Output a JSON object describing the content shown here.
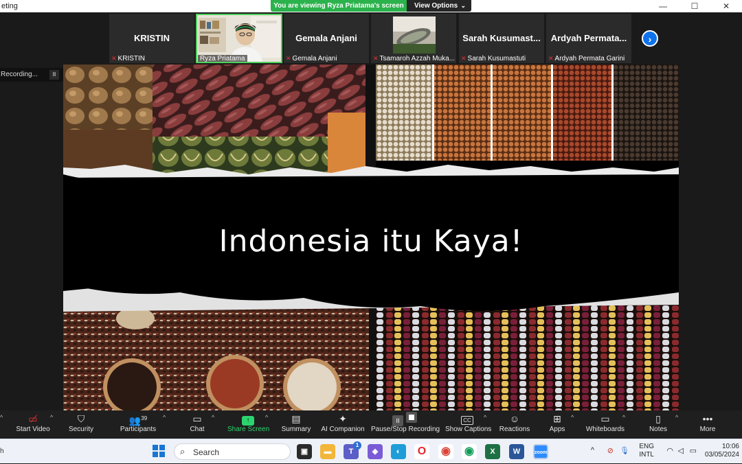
{
  "window": {
    "title": "eting",
    "controls": [
      "—",
      "☐",
      "✕"
    ]
  },
  "banner": {
    "viewing": "You are viewing Ryza Priatama's screen",
    "view_options": "View Options"
  },
  "participants": [
    {
      "name_big": "KRISTIN",
      "label": "KRISTIN",
      "muted": true,
      "video": false
    },
    {
      "name_big": "",
      "label": "Ryza Priatama",
      "muted": false,
      "video": true
    },
    {
      "name_big": "Gemala Anjani",
      "label": "Gemala Anjani",
      "muted": true,
      "video": false
    },
    {
      "name_big": "",
      "label": "Tsamaroh Azzah Muka...",
      "muted": true,
      "video": true
    },
    {
      "name_big": "Sarah Kusumast...",
      "label": "Sarah Kusumastuti",
      "muted": true,
      "video": false
    },
    {
      "name_big": "Ardyah Permata...",
      "label": "Ardyah Permata Garini",
      "muted": true,
      "video": false
    }
  ],
  "recording": {
    "text": "Recording...",
    "pause": "II"
  },
  "slide": {
    "title": "Indonesia itu Kaya!"
  },
  "toolbar": {
    "start_video": "Start Video",
    "security": "Security",
    "participants": "Participants",
    "participants_count": "39",
    "chat": "Chat",
    "share_screen": "Share Screen",
    "summary": "Summary",
    "ai_companion": "AI Companion",
    "pause_stop_recording": "Pause/Stop Recording",
    "show_captions": "Show Captions",
    "reactions": "Reactions",
    "apps": "Apps",
    "whiteboards": "Whiteboards",
    "notes": "Notes",
    "more": "More",
    "cc": "CC"
  },
  "taskbar": {
    "search_placeholder": "Search",
    "teams_badge": "1",
    "lang_top": "ENG",
    "lang_bottom": "INTL",
    "time": "10:06",
    "date": "03/05/2024",
    "left_edge": "h"
  },
  "colors": {
    "accent_green": "#2bb24c",
    "zoom_blue": "#0e72ed",
    "mute_red": "#e03434",
    "active_border": "#4fd15c"
  }
}
